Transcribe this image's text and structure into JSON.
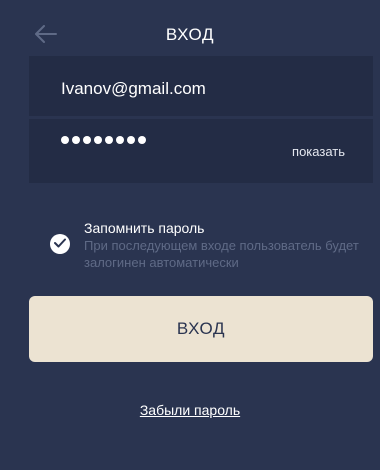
{
  "header": {
    "title": "ВХОД",
    "back_icon": "arrow-left-icon"
  },
  "form": {
    "email_value": "Ivanov@gmail.com",
    "password_masked": "••••••••",
    "show_label": "показать"
  },
  "remember": {
    "checked": true,
    "title": "Запомнить пароль",
    "description": "При последующем входе пользователь будет залогинен автоматически"
  },
  "login_button": {
    "label": "ВХОД"
  },
  "forgot_link": {
    "label": "Забыли пароль"
  },
  "colors": {
    "background": "#2a3450",
    "card": "#232c45",
    "button": "#ece3d2",
    "muted_text": "#5f6a86"
  }
}
